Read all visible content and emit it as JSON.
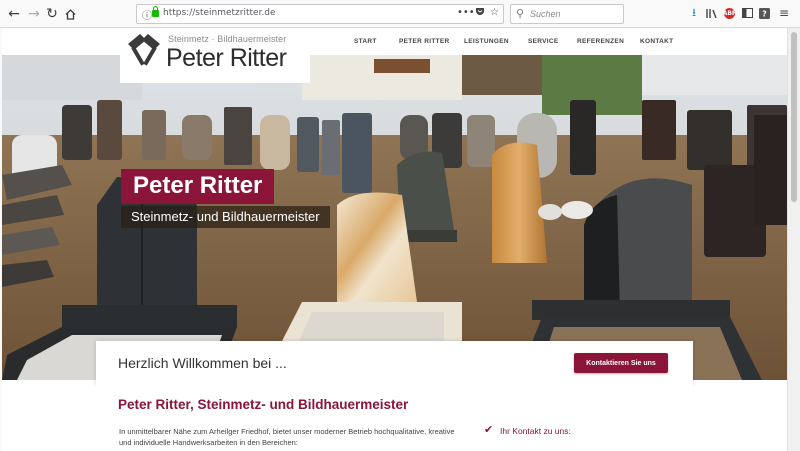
{
  "browser": {
    "url": "https://steinmetzritter.de",
    "search_placeholder": "Suchen",
    "page_actions": "•••"
  },
  "site": {
    "logo_subtitle": "Steinmetz  ·  Bildhauermeister",
    "logo_title": "Peter Ritter",
    "nav": [
      "START",
      "PETER RITTER",
      "LEISTUNGEN",
      "SERVICE",
      "REFERENZEN",
      "KONTAKT"
    ]
  },
  "hero": {
    "title": "Peter Ritter",
    "subtitle": "Steinmetz- und Bildhauermeister"
  },
  "welcome": {
    "text": "Herzlich Willkommen bei ...",
    "button": "Kontaktieren Sie uns"
  },
  "content": {
    "heading": "Peter Ritter, Steinmetz- und Bildhauermeister",
    "body": "In unmittelbarer Nähe zum Arheilger Friedhof, bietet unser moderner Betrieb hochqualitative, kreative und individuelle Handwerksarbeiten in den Bereichen:",
    "contact_label": "Ihr Kontakt zu uns:"
  },
  "colors": {
    "brand": "#8a1538",
    "toolbar": "#f9f9fa"
  }
}
